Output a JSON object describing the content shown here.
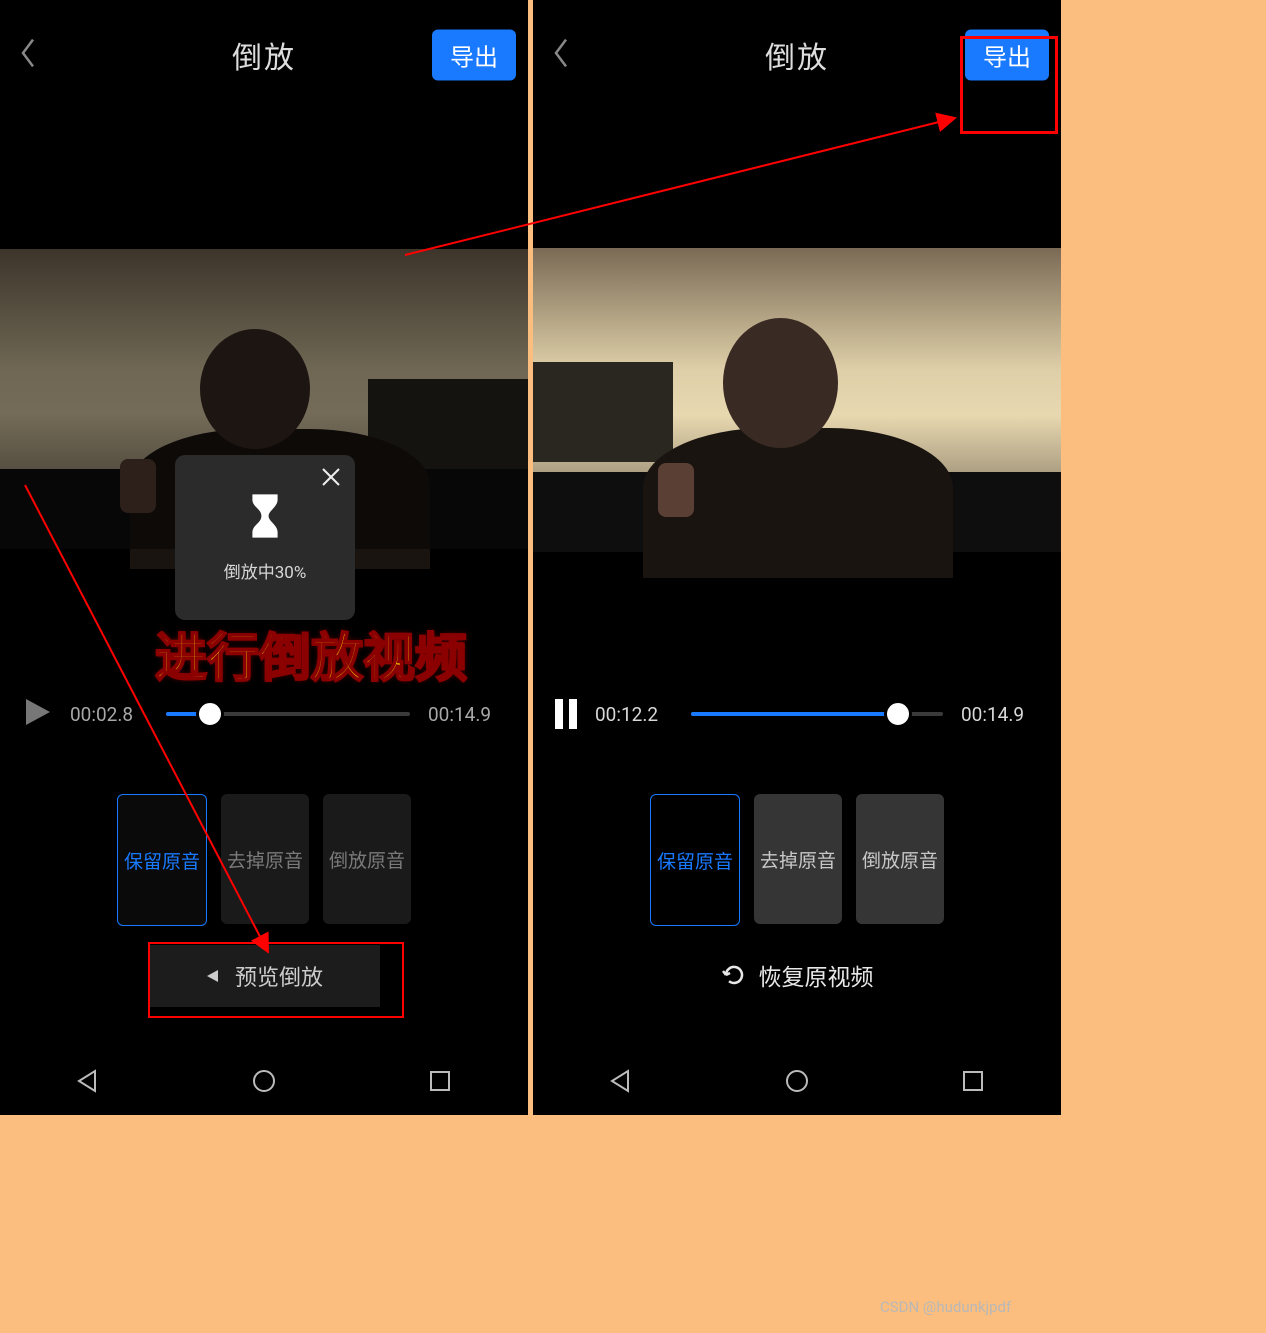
{
  "watermark": "CSDN @hudunkjpdf",
  "annotation_text": "进行倒放视频",
  "left": {
    "title": "倒放",
    "export_label": "导出",
    "modal_text": "倒放中30%",
    "current_time": "00:02.8",
    "total_time": "00:14.9",
    "audio_options": [
      "保留原音",
      "去掉原音",
      "倒放原音"
    ],
    "preview_button": "预览倒放"
  },
  "right": {
    "title": "倒放",
    "export_label": "导出",
    "current_time": "00:12.2",
    "total_time": "00:14.9",
    "audio_options": [
      "保留原音",
      "去掉原音",
      "倒放原音"
    ],
    "restore_label": "恢复原视频"
  }
}
